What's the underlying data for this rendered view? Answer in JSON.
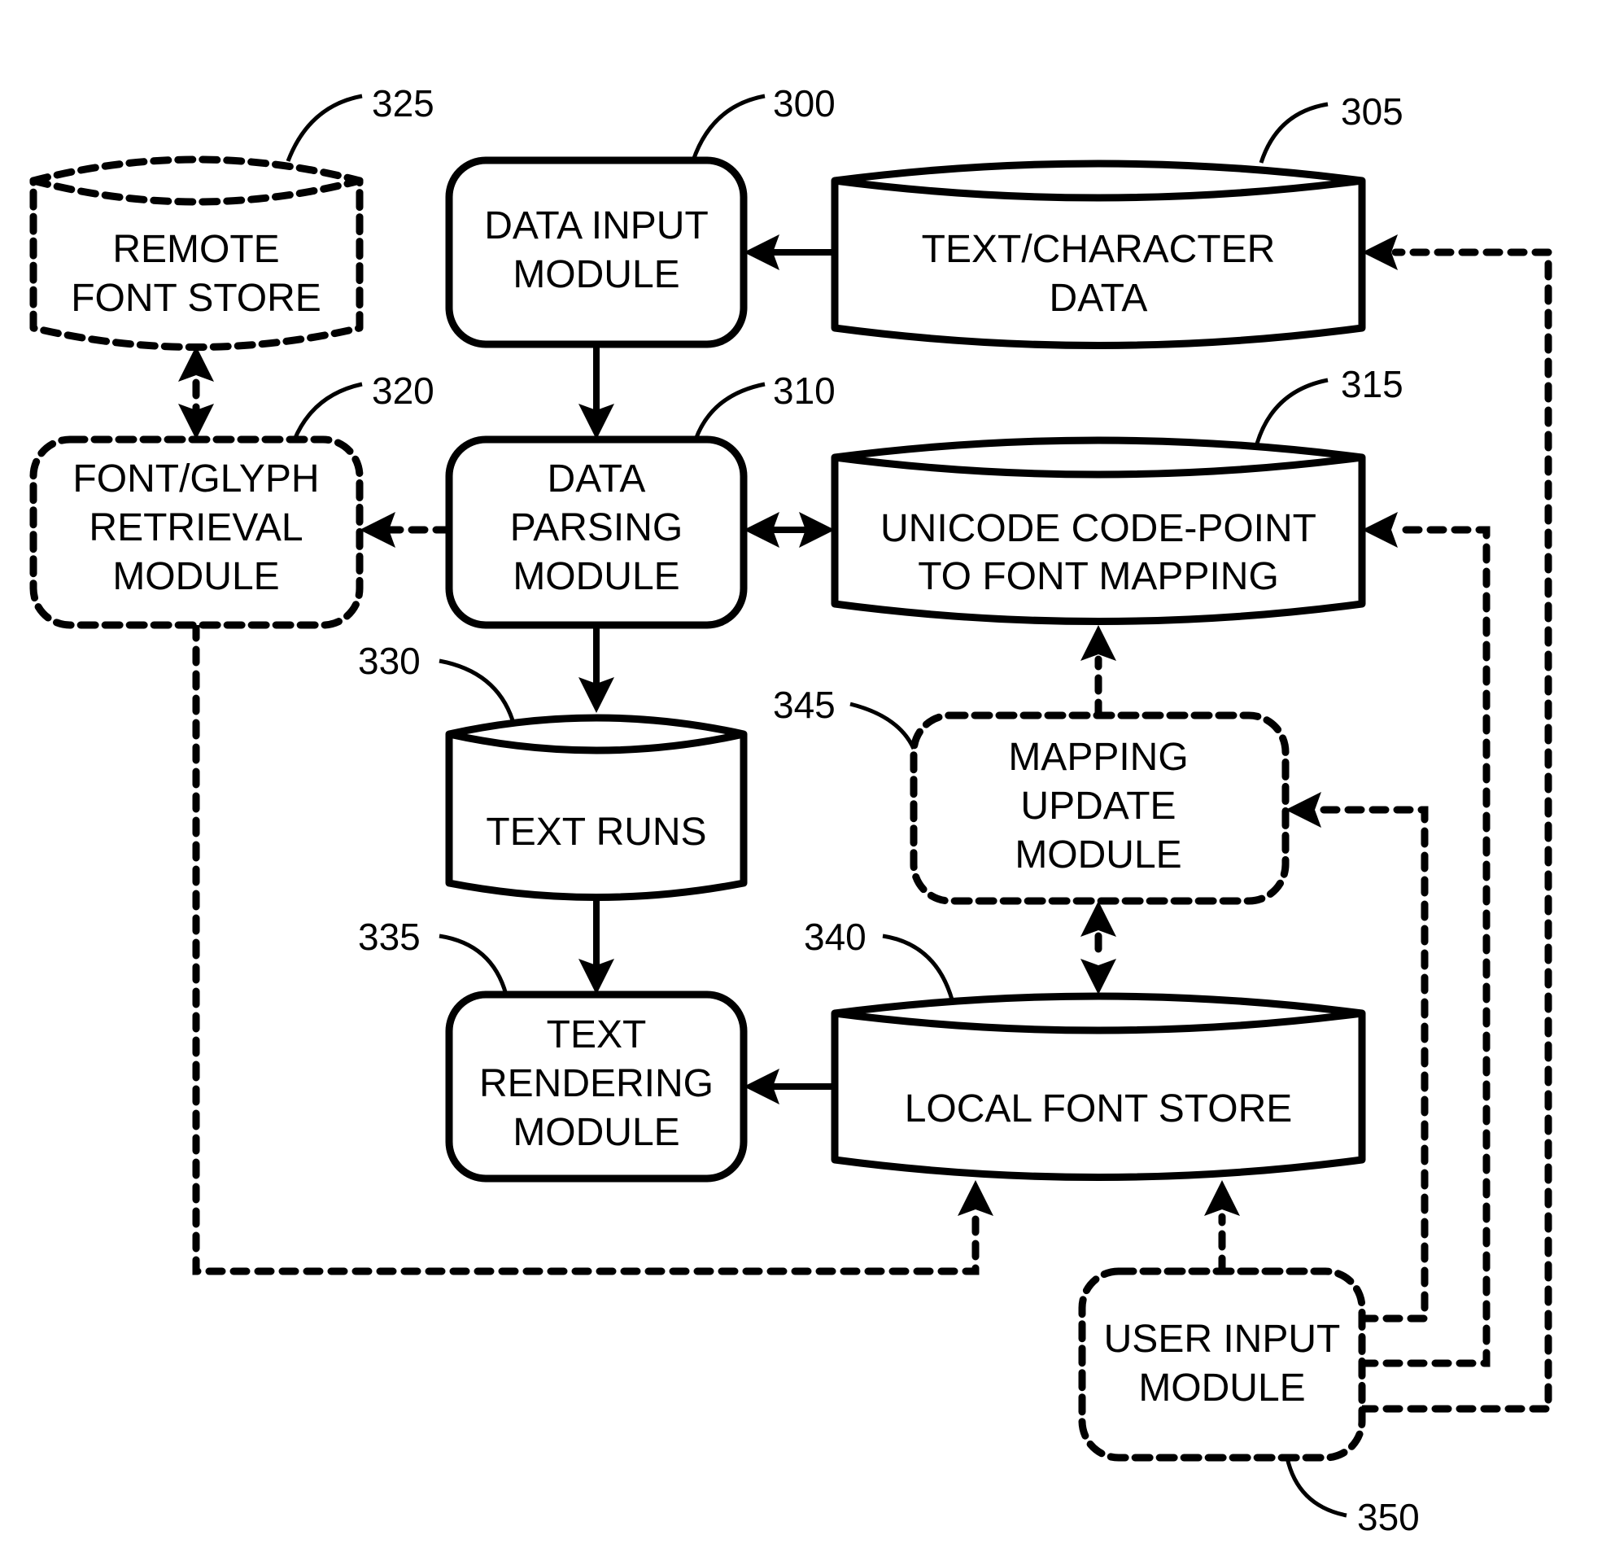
{
  "diagram": {
    "type": "block-diagram",
    "nodes": [
      {
        "id": "data_input",
        "ref": "300",
        "shape": "rounded-rect",
        "style": "solid",
        "lines": [
          "DATA INPUT",
          "MODULE"
        ]
      },
      {
        "id": "text_char_data",
        "ref": "305",
        "shape": "cylinder",
        "style": "solid",
        "lines": [
          "TEXT/CHARACTER",
          "DATA"
        ]
      },
      {
        "id": "data_parsing",
        "ref": "310",
        "shape": "rounded-rect",
        "style": "solid",
        "lines": [
          "DATA",
          "PARSING",
          "MODULE"
        ]
      },
      {
        "id": "unicode_mapping",
        "ref": "315",
        "shape": "cylinder",
        "style": "solid",
        "lines": [
          "UNICODE CODE-POINT",
          "TO FONT MAPPING"
        ]
      },
      {
        "id": "font_glyph_retrieval",
        "ref": "320",
        "shape": "rounded-rect",
        "style": "dashed",
        "lines": [
          "FONT/GLYPH",
          "RETRIEVAL",
          "MODULE"
        ]
      },
      {
        "id": "remote_font_store",
        "ref": "325",
        "shape": "cylinder",
        "style": "dashed",
        "lines": [
          "REMOTE",
          "FONT STORE"
        ]
      },
      {
        "id": "text_runs",
        "ref": "330",
        "shape": "cylinder",
        "style": "solid",
        "lines": [
          "TEXT RUNS"
        ]
      },
      {
        "id": "text_rendering",
        "ref": "335",
        "shape": "rounded-rect",
        "style": "solid",
        "lines": [
          "TEXT",
          "RENDERING",
          "MODULE"
        ]
      },
      {
        "id": "local_font_store",
        "ref": "340",
        "shape": "cylinder",
        "style": "solid",
        "lines": [
          "LOCAL FONT STORE"
        ]
      },
      {
        "id": "mapping_update",
        "ref": "345",
        "shape": "rounded-rect",
        "style": "dashed",
        "lines": [
          "MAPPING",
          "UPDATE",
          "MODULE"
        ]
      },
      {
        "id": "user_input",
        "ref": "350",
        "shape": "rounded-rect",
        "style": "dashed",
        "lines": [
          "USER INPUT",
          "MODULE"
        ]
      }
    ],
    "edges": [
      {
        "from": "text_char_data",
        "to": "data_input",
        "style": "solid",
        "direction": "forward"
      },
      {
        "from": "data_input",
        "to": "data_parsing",
        "style": "solid",
        "direction": "forward"
      },
      {
        "from": "data_parsing",
        "to": "unicode_mapping",
        "style": "solid",
        "direction": "both"
      },
      {
        "from": "data_parsing",
        "to": "font_glyph_retrieval",
        "style": "dashed",
        "direction": "forward"
      },
      {
        "from": "font_glyph_retrieval",
        "to": "remote_font_store",
        "style": "dashed",
        "direction": "both"
      },
      {
        "from": "data_parsing",
        "to": "text_runs",
        "style": "solid",
        "direction": "forward"
      },
      {
        "from": "text_runs",
        "to": "text_rendering",
        "style": "solid",
        "direction": "forward"
      },
      {
        "from": "local_font_store",
        "to": "text_rendering",
        "style": "solid",
        "direction": "forward"
      },
      {
        "from": "mapping_update",
        "to": "unicode_mapping",
        "style": "dashed",
        "direction": "forward"
      },
      {
        "from": "mapping_update",
        "to": "local_font_store",
        "style": "dashed",
        "direction": "both"
      },
      {
        "from": "font_glyph_retrieval",
        "to": "local_font_store",
        "style": "dashed",
        "direction": "forward"
      },
      {
        "from": "user_input",
        "to": "local_font_store",
        "style": "dashed",
        "direction": "forward"
      },
      {
        "from": "user_input",
        "to": "mapping_update",
        "style": "dashed",
        "direction": "forward"
      },
      {
        "from": "user_input",
        "to": "unicode_mapping",
        "style": "dashed",
        "direction": "forward"
      },
      {
        "from": "user_input",
        "to": "text_char_data",
        "style": "dashed",
        "direction": "forward"
      }
    ]
  }
}
